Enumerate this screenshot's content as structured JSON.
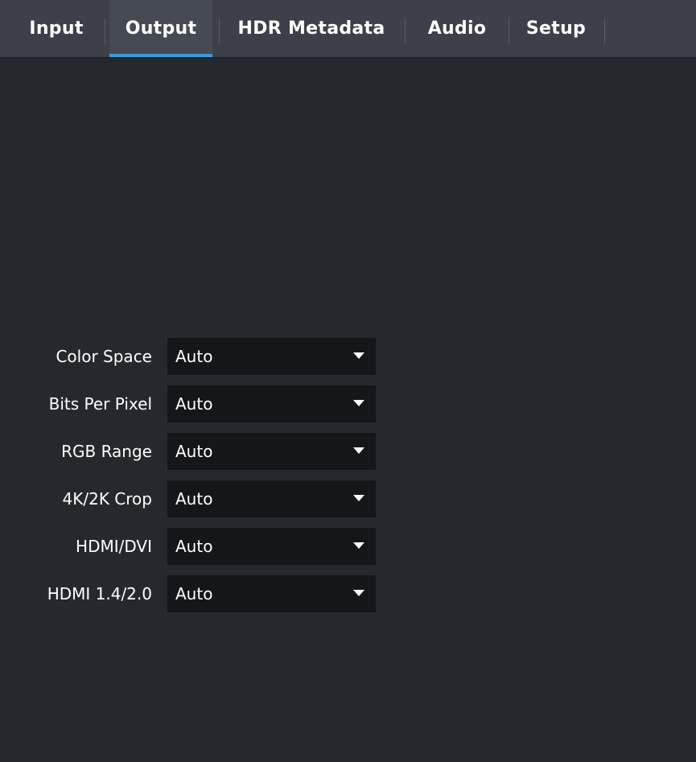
{
  "tabs": {
    "input": "Input",
    "output": "Output",
    "hdr_metadata": "HDR Metadata",
    "audio": "Audio",
    "setup": "Setup",
    "active": "Output"
  },
  "settings": {
    "color_space": {
      "label": "Color Space",
      "value": "Auto"
    },
    "bits_per_pixel": {
      "label": "Bits Per Pixel",
      "value": "Auto"
    },
    "rgb_range": {
      "label": "RGB Range",
      "value": "Auto"
    },
    "crop_4k2k": {
      "label": "4K/2K Crop",
      "value": "Auto"
    },
    "hdmi_dvi": {
      "label": "HDMI/DVI",
      "value": "Auto"
    },
    "hdmi_version": {
      "label": "HDMI 1.4/2.0",
      "value": "Auto"
    }
  },
  "icons": {
    "dropdown": "caret-down-icon"
  },
  "colors": {
    "accent": "#3f97d8",
    "tabbar_bg": "#3d4048",
    "content_bg": "#24272c",
    "select_bg": "#141619",
    "text": "#ffffff"
  }
}
